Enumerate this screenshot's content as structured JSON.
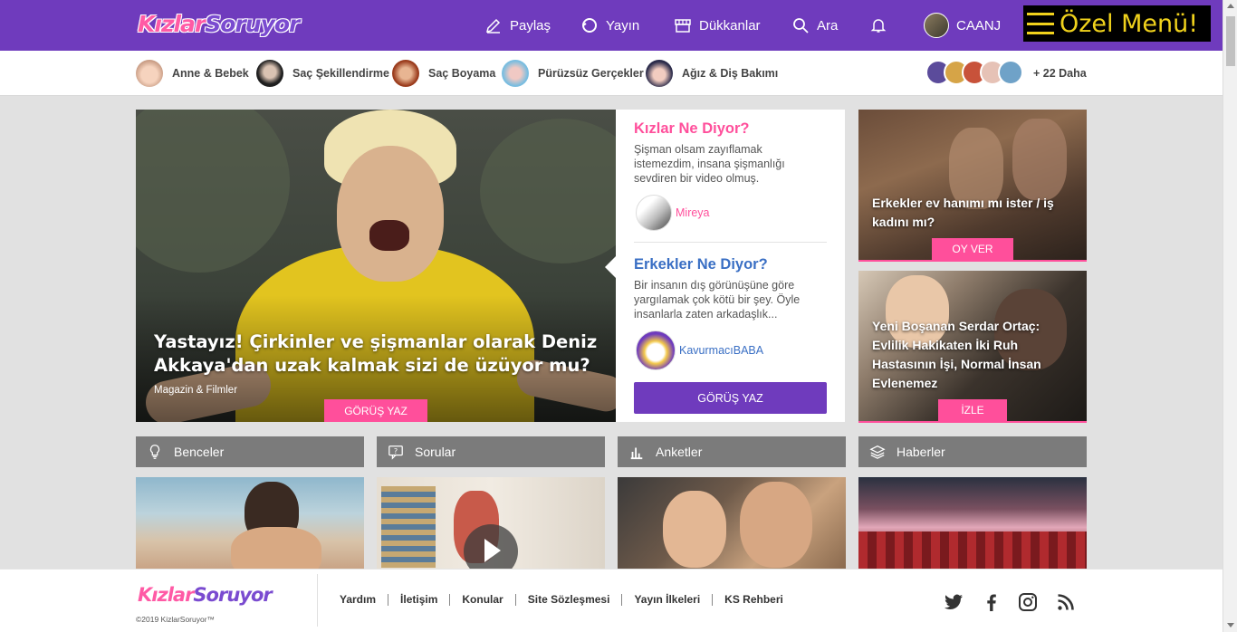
{
  "header": {
    "logo_part1": "Kızlar",
    "logo_part2": "Soruyor",
    "nav": [
      "Paylaş",
      "Yayın",
      "Dükkanlar",
      "Ara"
    ],
    "username": "CAANJ",
    "special_menu": "Özel Menü!"
  },
  "categories": [
    "Anne & Bebek",
    "Saç Şekillendirme",
    "Saç Boyama",
    "Pürüzsüz Gerçekler",
    "Ağız & Diş Bakımı"
  ],
  "categories_more": "+ 22 Daha",
  "hero": {
    "title": "Yastayız! Çirkinler ve şişmanlar olarak Deniz Akkaya'dan uzak kalmak sizi de üzüyor mu?",
    "category": "Magazin & Filmler",
    "button": "GÖRÜŞ YAZ"
  },
  "opinions": {
    "women": {
      "heading": "Kızlar Ne Diyor?",
      "text": "Şişman olsam zayıflamak istemezdim, insana şişmanlığı sevdiren bir video olmuş.",
      "user": "Mireya"
    },
    "men": {
      "heading": "Erkekler Ne Diyor?",
      "text": "Bir insanın dış görünüşüne göre yargılamak çok kötü bir şey. Öyle insanlarla zaten arkadaşlık...",
      "user": "KavurmacıBABA"
    },
    "button": "GÖRÜŞ YAZ"
  },
  "side_cards": [
    {
      "title": "Erkekler ev hanımı mı ister / iş kadını mı?",
      "button": "OY VER"
    },
    {
      "title": "Yeni Boşanan Serdar Ortaç: Evlilik Hakikaten İki Ruh Hastasının İşi, Normal İnsan Evlenemez",
      "button": "İZLE"
    }
  ],
  "sections": [
    "Benceler",
    "Sorular",
    "Anketler",
    "Haberler"
  ],
  "footer": {
    "logo_part1": "Kızlar",
    "logo_part2": "Soruyor",
    "copyright": "©2019 KizlarSoruyor™",
    "links": [
      "Yardım",
      "İletişim",
      "Konular",
      "Site Sözleşmesi",
      "Yayın İlkeleri",
      "KS Rehberi"
    ]
  },
  "colors": {
    "brand_purple": "#6f3bbd",
    "accent_pink": "#ff4f9b",
    "women_heading": "#ff4f9b",
    "men_heading": "#3a6fc4",
    "section_bar": "#7b7b7b"
  }
}
